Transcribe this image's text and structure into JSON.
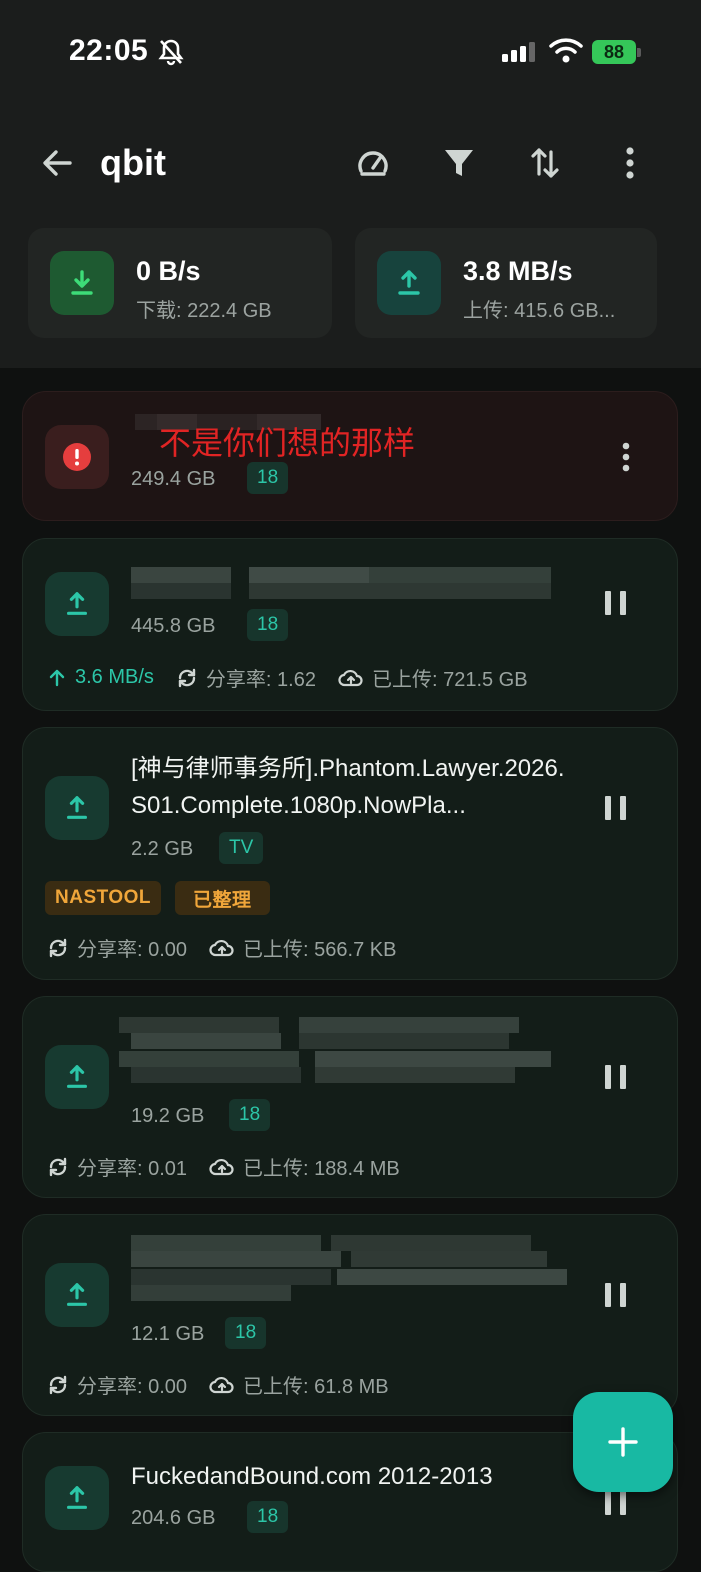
{
  "status_bar": {
    "time": "22:05",
    "battery": "88"
  },
  "app_bar": {
    "title": "qbit"
  },
  "speeds": {
    "download": {
      "value": "0 B/s",
      "total": "下载: 222.4 GB"
    },
    "upload": {
      "value": "3.8 MB/s",
      "total": "上传: 415.6 GB..."
    }
  },
  "torrents": [
    {
      "state": "error",
      "name": "",
      "overlay_text": "不是你们想的那样",
      "size": "249.4 GB",
      "tag": "18"
    },
    {
      "state": "seeding",
      "name": "",
      "size": "445.8 GB",
      "tag": "18",
      "up_speed": "3.6 MB/s",
      "ratio": "分享率: 1.62",
      "uploaded": "已上传: 721.5 GB"
    },
    {
      "state": "seeding",
      "name": "[神与律师事务所].Phantom.Lawyer.2026.S01.Complete.1080p.NowPla...",
      "size": "2.2 GB",
      "tag": "TV",
      "labels": [
        "NASTOOL",
        "已整理"
      ],
      "ratio": "分享率: 0.00",
      "uploaded": "已上传: 566.7 KB"
    },
    {
      "state": "seeding",
      "name": "",
      "size": "19.2 GB",
      "tag": "18",
      "ratio": "分享率: 0.01",
      "uploaded": "已上传: 188.4 MB"
    },
    {
      "state": "seeding",
      "name": "",
      "size": "12.1 GB",
      "tag": "18",
      "ratio": "分享率: 0.00",
      "uploaded": "已上传: 61.8 MB"
    },
    {
      "state": "seeding",
      "name": "FuckedandBound.com 2012-2013",
      "size": "204.6 GB",
      "tag": "18"
    }
  ],
  "colors": {
    "accent": "#2cc6a8",
    "fab": "#18b9a3",
    "error": "#e53e3e",
    "label_orange": "#f0a63a"
  },
  "icons": {
    "back": "arrow-left-icon",
    "speed": "speedometer-icon",
    "filter": "filter-icon",
    "sort": "sort-arrows-icon",
    "more": "more-vertical-icon",
    "add": "plus-icon"
  }
}
